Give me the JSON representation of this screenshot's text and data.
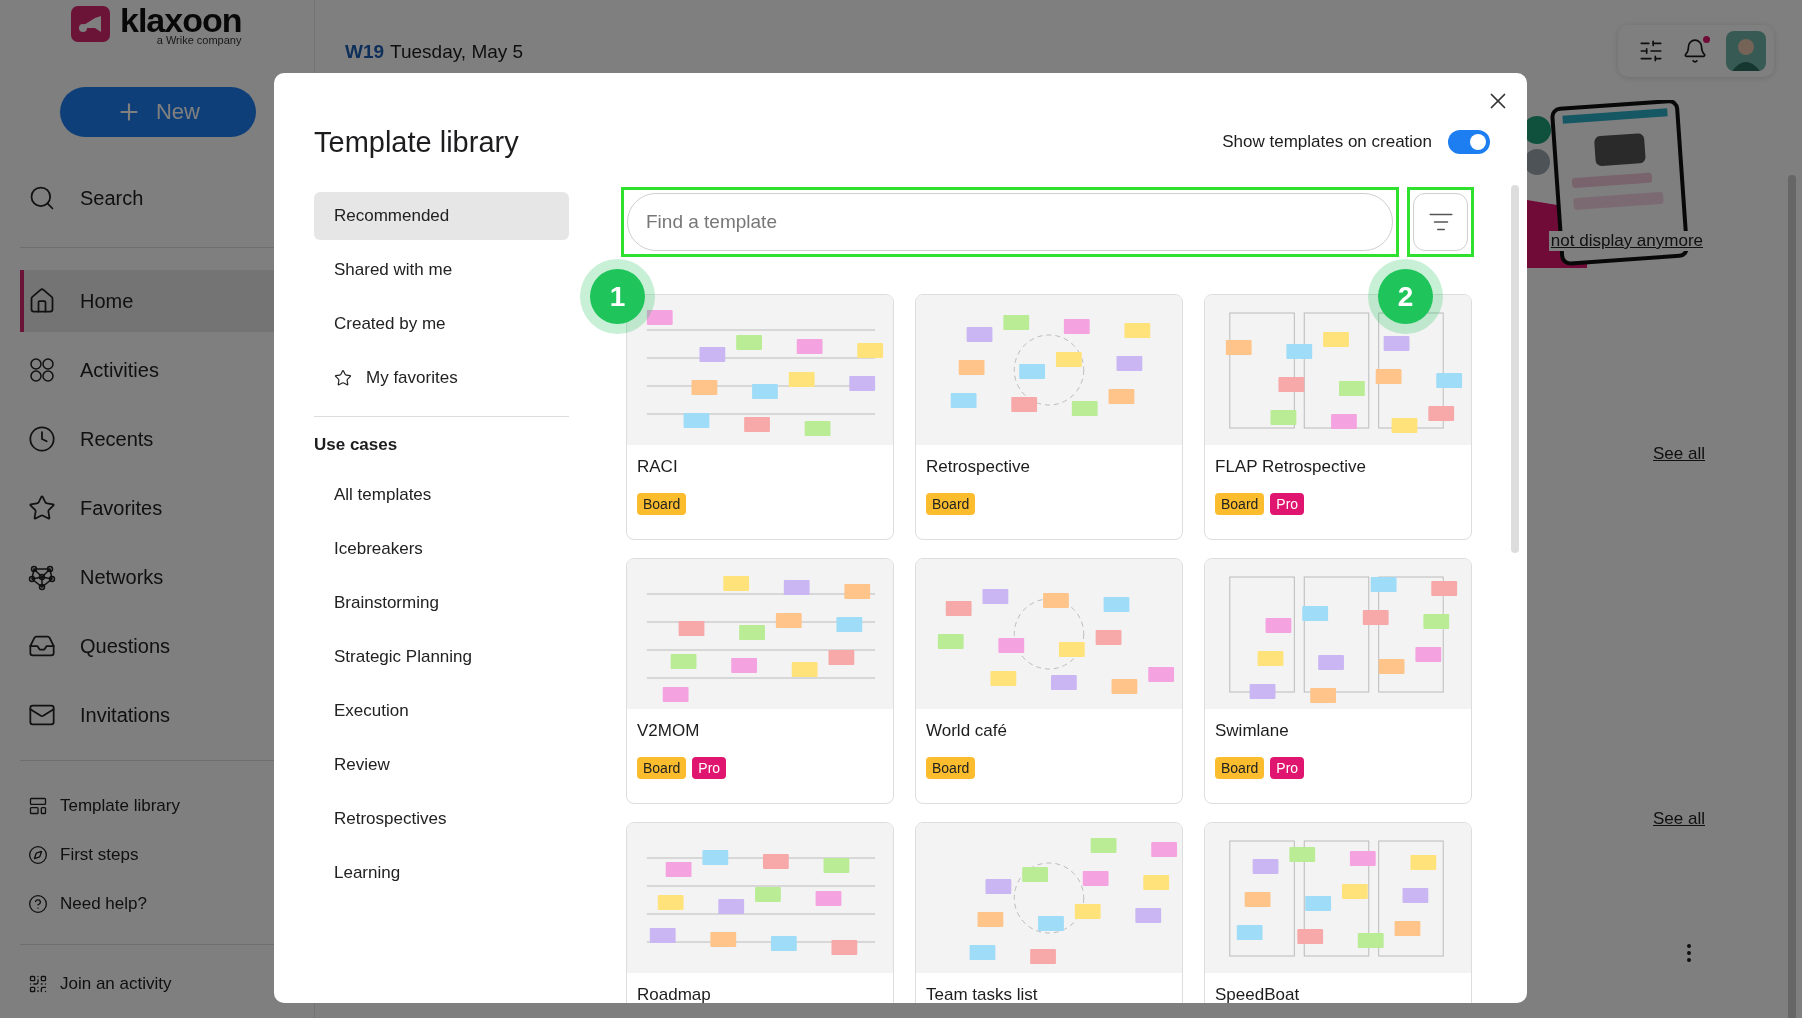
{
  "sidebar": {
    "logo": "klaxoon",
    "logo_tagline": "a Wrike company",
    "new_button": "New",
    "search": "Search",
    "nav": [
      {
        "label": "Home",
        "kind": "home",
        "selected": true
      },
      {
        "label": "Activities",
        "kind": "activities",
        "selected": false
      },
      {
        "label": "Recents",
        "kind": "recents",
        "selected": false
      },
      {
        "label": "Favorites",
        "kind": "favorites",
        "selected": false
      },
      {
        "label": "Networks",
        "kind": "networks",
        "selected": false
      },
      {
        "label": "Questions",
        "kind": "questions",
        "selected": false
      },
      {
        "label": "Invitations",
        "kind": "invitations",
        "selected": false
      }
    ],
    "links": [
      {
        "label": "Template library",
        "kind": "template"
      },
      {
        "label": "First steps",
        "kind": "steps"
      },
      {
        "label": "Need help?",
        "kind": "help"
      }
    ],
    "join": "Join an activity"
  },
  "header": {
    "week": "W19",
    "date": "Tuesday, May 5",
    "notifications_unread": true
  },
  "background": {
    "dismiss_link": "not display anymore",
    "see_all": [
      "See all",
      "See all"
    ]
  },
  "modal": {
    "title": "Template library",
    "toggle": {
      "label": "Show templates on creation",
      "on": true
    },
    "nav": [
      {
        "label": "Recommended",
        "selected": true,
        "kind": "plain"
      },
      {
        "label": "Shared with me",
        "selected": false,
        "kind": "plain"
      },
      {
        "label": "Created by me",
        "selected": false,
        "kind": "plain"
      },
      {
        "label": "My favorites",
        "selected": false,
        "kind": "favorites"
      }
    ],
    "use_cases_heading": "Use cases",
    "use_cases": [
      {
        "label": "All templates",
        "selected": false
      },
      {
        "label": "Icebreakers",
        "selected": false
      },
      {
        "label": "Brainstorming",
        "selected": false
      },
      {
        "label": "Strategic Planning",
        "selected": false
      },
      {
        "label": "Execution",
        "selected": false
      },
      {
        "label": "Review",
        "selected": false
      },
      {
        "label": "Retrospectives",
        "selected": false
      },
      {
        "label": "Learning",
        "selected": false
      }
    ],
    "search": {
      "placeholder": "Find a template",
      "highlighted": true
    },
    "filter": {
      "highlighted": true
    },
    "callouts": [
      {
        "label": "1"
      },
      {
        "label": "2"
      }
    ],
    "templates": [
      {
        "name": "RACI",
        "tags": [
          {
            "label": "Board",
            "kind": "board"
          }
        ]
      },
      {
        "name": "Retrospective",
        "tags": [
          {
            "label": "Board",
            "kind": "board"
          }
        ]
      },
      {
        "name": "FLAP Retrospective",
        "tags": [
          {
            "label": "Board",
            "kind": "board"
          },
          {
            "label": "Pro",
            "kind": "pro"
          }
        ]
      },
      {
        "name": "V2MOM",
        "tags": [
          {
            "label": "Board",
            "kind": "board"
          },
          {
            "label": "Pro",
            "kind": "pro"
          }
        ]
      },
      {
        "name": "World café",
        "tags": [
          {
            "label": "Board",
            "kind": "board"
          }
        ]
      },
      {
        "name": "Swimlane",
        "tags": [
          {
            "label": "Board",
            "kind": "board"
          },
          {
            "label": "Pro",
            "kind": "pro"
          }
        ]
      },
      {
        "name": "Roadmap"
      },
      {
        "name": "Team tasks list"
      },
      {
        "name": "SpeedBoat"
      }
    ]
  }
}
